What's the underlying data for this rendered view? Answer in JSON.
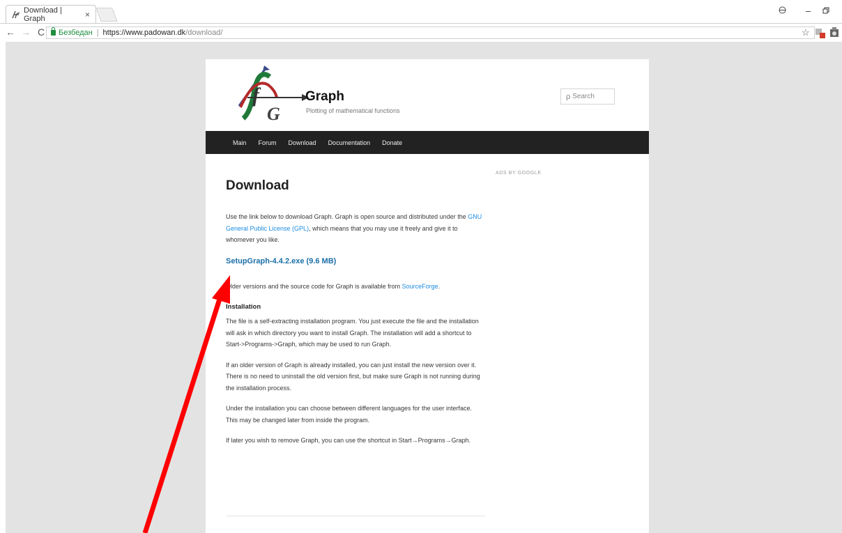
{
  "browser": {
    "tab_title": "Download | Graph",
    "tab_close": "×",
    "security_label": "Безбедан",
    "url_host": "https://www.padowan.dk",
    "url_path": "/download/"
  },
  "site": {
    "title": "Graph",
    "description": "Plotting of mathematical functions",
    "search_placeholder": "Search"
  },
  "nav": {
    "items": [
      "Main",
      "Forum",
      "Download",
      "Documentation",
      "Donate"
    ]
  },
  "content": {
    "heading": "Download",
    "intro_before": "Use the link below to download Graph. Graph is open source and distributed under the ",
    "license_link": "GNU General Public License (GPL)",
    "intro_after": ", which means that you may use it freely and give it to whomever you like.",
    "download_link": "SetupGraph-4.4.2.exe (9.6 MB)",
    "older_before": "Older versions and the source code for Graph is available from ",
    "sourceforge_link": "SourceForge",
    "older_after": ".",
    "installation_title": "Installation",
    "para1": "The file is a self-extracting installation program. You just execute the file and the installation will ask in which directory you want to install Graph. The installation will add a shortcut to Start->Programs->Graph, which may be used to run Graph.",
    "para2": "If an older version of Graph is already installed, you can just install the new version over it. There is no need to uninstall the old version first, but make sure Graph is not running during the installation process.",
    "para3": "Under the installation you can choose between different languages for the user interface. This may be changed later from inside the program.",
    "para4": "If later you wish to remove Graph, you can use the shortcut in Start→Programs→Graph."
  },
  "sidebar": {
    "ads_label": "ADS BY GOOGLE"
  },
  "colors": {
    "annotation_arrow": "#ff0000",
    "nav_background": "#222222",
    "link": "#1b8be0"
  },
  "icons": [
    "graph-favicon-icon",
    "back-icon",
    "forward-icon",
    "reload-icon",
    "lock-icon",
    "star-icon",
    "search-icon",
    "account-icon",
    "minimize-icon",
    "restore-icon"
  ]
}
